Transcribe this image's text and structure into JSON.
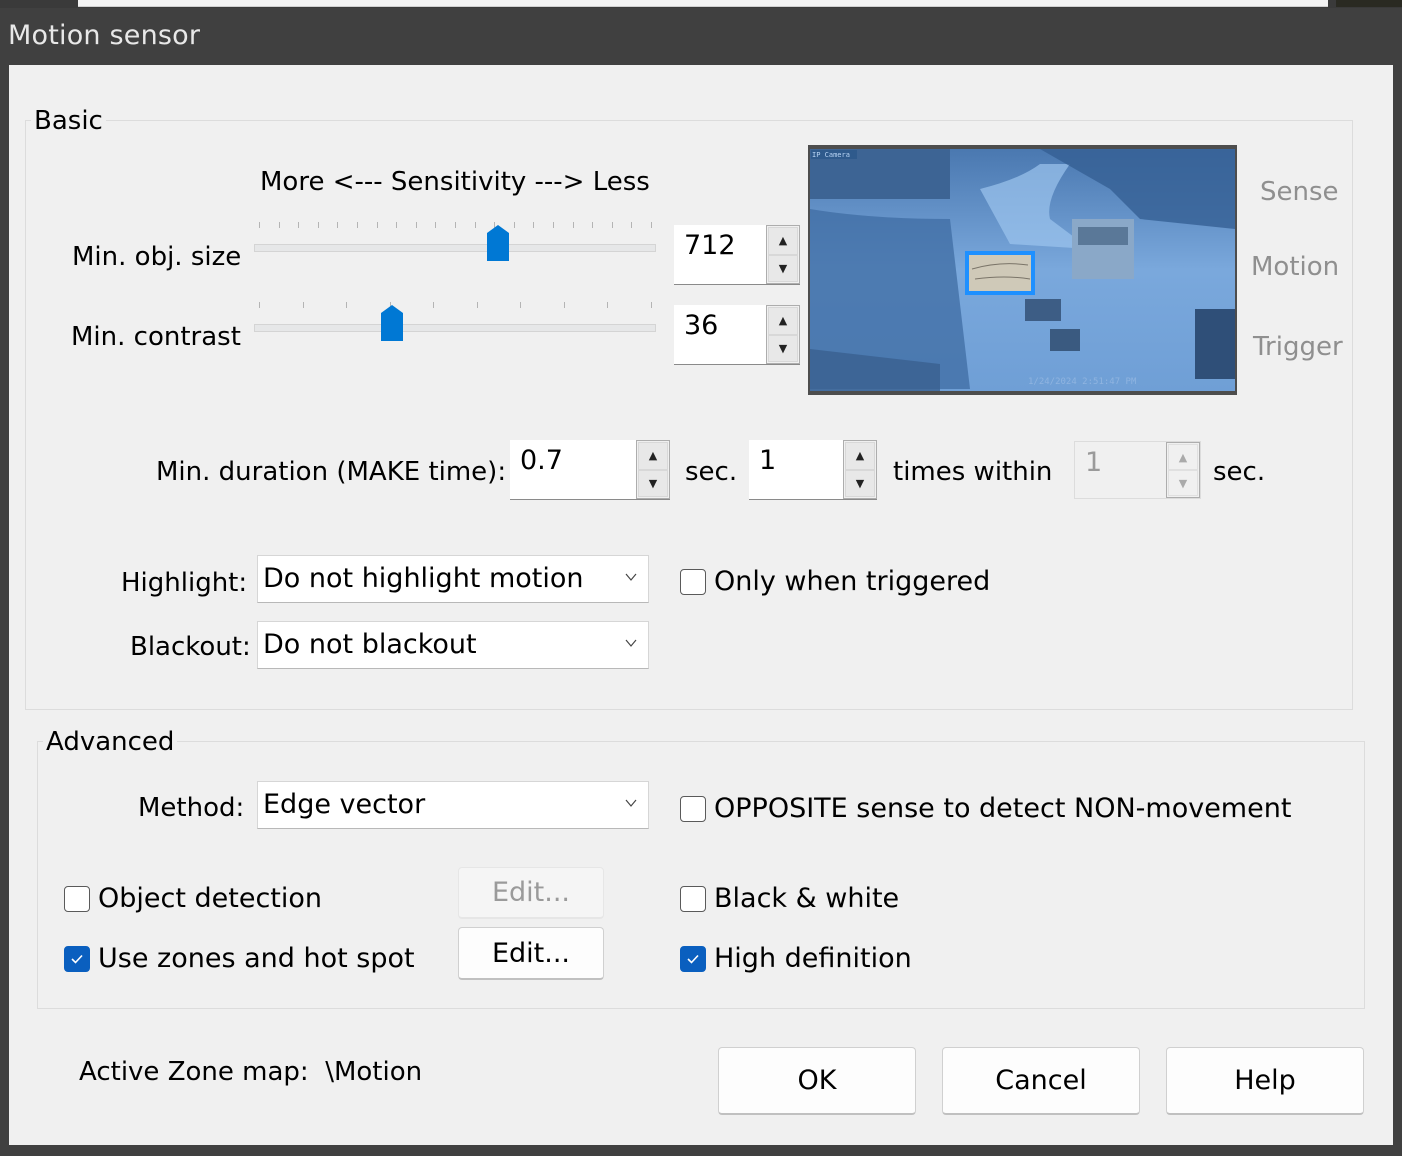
{
  "window": {
    "title": "Motion sensor"
  },
  "basic": {
    "group_label": "Basic",
    "sensitivity_caption": "More <--- Sensitivity ---> Less",
    "min_obj_size": {
      "label": "Min. obj. size",
      "value": "712",
      "slider_fraction": 0.61,
      "tick_count": 21
    },
    "min_contrast": {
      "label": "Min. contrast",
      "value": "36",
      "slider_fraction": 0.34,
      "tick_count": 10
    },
    "camera": {
      "overlay_text": "IP Camera",
      "timestamp": "1/24/2024 2:51:47 PM",
      "accent_color": "#1e90ff"
    },
    "indicators": [
      "Sense",
      "Motion",
      "Trigger"
    ],
    "min_duration": {
      "label": "Min. duration (MAKE time):",
      "value": "0.7",
      "unit": "sec.",
      "times_value": "1",
      "times_label": "times within",
      "within_value": "1",
      "within_unit": "sec."
    },
    "highlight": {
      "label": "Highlight:",
      "value": "Do not highlight motion"
    },
    "only_when_triggered": {
      "label": "Only when triggered",
      "checked": false
    },
    "blackout": {
      "label": "Blackout:",
      "value": "Do not blackout"
    }
  },
  "advanced": {
    "group_label": "Advanced",
    "method": {
      "label": "Method:",
      "value": "Edge vector"
    },
    "opposite_sense": {
      "label": "OPPOSITE sense to detect NON-movement",
      "checked": false
    },
    "object_detection": {
      "label": "Object detection",
      "checked": false,
      "edit_label": "Edit...",
      "edit_enabled": false
    },
    "use_zones": {
      "label": "Use zones and hot spot",
      "checked": true,
      "edit_label": "Edit...",
      "edit_enabled": true
    },
    "black_white": {
      "label": "Black & white",
      "checked": false
    },
    "high_definition": {
      "label": "High definition",
      "checked": true
    }
  },
  "footer": {
    "active_zone_label": "Active Zone map:",
    "active_zone_value": "\\Motion",
    "ok_label": "OK",
    "cancel_label": "Cancel",
    "help_label": "Help"
  },
  "colors": {
    "accent": "#0078d4",
    "checkbox_checked": "#0a5fbf",
    "titlebar": "#404040",
    "dialog_bg": "#f0f0f0"
  }
}
